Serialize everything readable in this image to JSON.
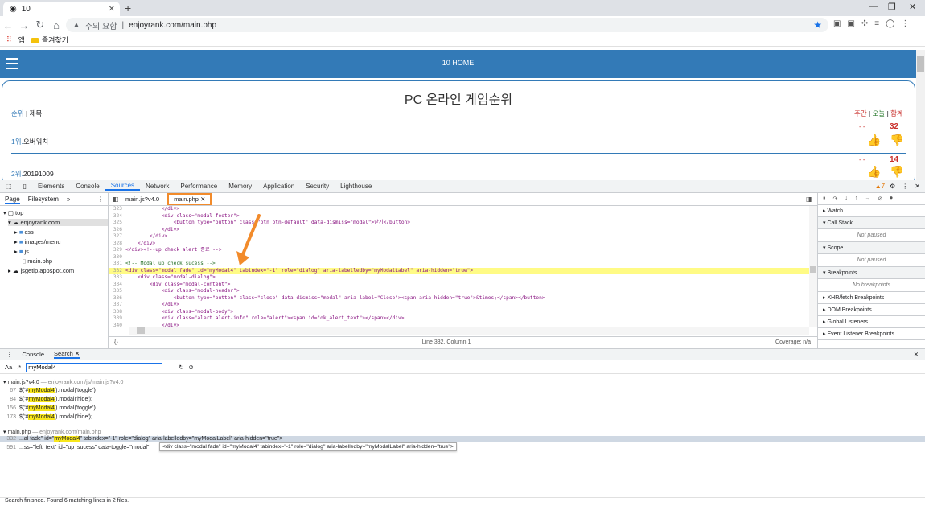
{
  "browser": {
    "tab_title": "10",
    "new_tab": "+",
    "address_warning": "주의 요함",
    "url": "enjoyrank.com/main.php",
    "bookmarks": [
      "앱",
      "즐겨찾기"
    ]
  },
  "page": {
    "nav_title": "10 HOME",
    "title": "PC 온라인 게임순위",
    "left_links": {
      "rank": "순위",
      "sep": " | ",
      "title": "제목"
    },
    "right_links": {
      "weekly": "주간",
      "sep1": " | ",
      "today": "오늘",
      "sep2": " | ",
      "total": "합계"
    },
    "rows": [
      {
        "rank": "1위.",
        "name": "오버워치",
        "dashes": "-    -   ",
        "count": "32"
      },
      {
        "rank": "2위.",
        "name": "20191009",
        "dashes": "-    -   ",
        "count": "14"
      }
    ]
  },
  "devtools": {
    "tabs": [
      "Elements",
      "Console",
      "Sources",
      "Network",
      "Performance",
      "Memory",
      "Application",
      "Security",
      "Lighthouse"
    ],
    "active_tab": "Sources",
    "warning_count": "7",
    "navigator": {
      "tabs": [
        "Page",
        "Filesystem"
      ],
      "tree": [
        {
          "label": "top",
          "level": 0
        },
        {
          "label": "enjoyrank.com",
          "level": 1
        },
        {
          "label": "css",
          "level": 2
        },
        {
          "label": "images/menu",
          "level": 2
        },
        {
          "label": "js",
          "level": 2
        },
        {
          "label": "main.php",
          "level": 2
        },
        {
          "label": "jsgetip.appspot.com",
          "level": 1
        }
      ]
    },
    "editor_tabs": [
      "main.js?v4.0",
      "main.php"
    ],
    "status": {
      "format": "{}",
      "position": "Line 332, Column 1",
      "coverage": "Coverage: n/a"
    },
    "code_lines": [
      {
        "n": "323",
        "t": "            </div>"
      },
      {
        "n": "324",
        "t": "            <div class=\"modal-footer\">"
      },
      {
        "n": "325",
        "t": "                <button type=\"button\" class=\"btn btn-default\" data-dismiss=\"modal\">닫기</button>"
      },
      {
        "n": "326",
        "t": "            </div>"
      },
      {
        "n": "327",
        "t": "        </div>"
      },
      {
        "n": "328",
        "t": "    </div>"
      },
      {
        "n": "329",
        "t": "</div><!--up check alert 종료 -->"
      },
      {
        "n": "330",
        "t": ""
      },
      {
        "n": "331",
        "t": "<!-- Modal up check sucess -->"
      },
      {
        "n": "332",
        "t": "<div class=\"modal fade\" id=\"myModal4\" tabindex=\"-1\" role=\"dialog\" aria-labelledby=\"myModalLabel\" aria-hidden=\"true\">"
      },
      {
        "n": "333",
        "t": "    <div class=\"modal-dialog\">"
      },
      {
        "n": "334",
        "t": "        <div class=\"modal-content\">"
      },
      {
        "n": "335",
        "t": "            <div class=\"modal-header\">"
      },
      {
        "n": "336",
        "t": "                <button type=\"button\" class=\"close\" data-dismiss=\"modal\" aria-label=\"Close\"><span aria-hidden=\"true\">&times;</span></button>"
      },
      {
        "n": "337",
        "t": "            </div>"
      },
      {
        "n": "338",
        "t": "            <div class=\"modal-body\">"
      },
      {
        "n": "339",
        "t": "            <div class=\"alert alert-info\" role=\"alert\"><span id=\"ok_alert_text\"></span></div>"
      },
      {
        "n": "340",
        "t": "            </div>"
      },
      {
        "n": "341",
        "t": ""
      }
    ],
    "debugger": {
      "watch": "Watch",
      "call_stack": "Call Stack",
      "not_paused": "Not paused",
      "scope": "Scope",
      "breakpoints": "Breakpoints",
      "no_breakpoints": "No breakpoints",
      "xhr": "XHR/fetch Breakpoints",
      "dom": "DOM Breakpoints",
      "global": "Global Listeners",
      "event": "Event Listener Breakpoints"
    },
    "drawer": {
      "tabs": [
        "Console",
        "Search"
      ],
      "aa": "Aa",
      "regex": ".*",
      "query": "myModal4",
      "files": [
        {
          "name": "main.js?v4.0",
          "path": "— enjoyrank.com/js/main.js?v4.0",
          "lines": [
            {
              "n": "67",
              "pre": "$('#",
              "match": "myModal4",
              "post": "').modal('toggle')"
            },
            {
              "n": "84",
              "pre": "$('#",
              "match": "myModal4",
              "post": "').modal('hide');"
            },
            {
              "n": "156",
              "pre": "$('#",
              "match": "myModal4",
              "post": "').modal('toggle')"
            },
            {
              "n": "173",
              "pre": "$('#",
              "match": "myModal4",
              "post": "').modal('hide');"
            }
          ]
        },
        {
          "name": "main.php",
          "path": "— enjoyrank.com/main.php",
          "lines": [
            {
              "n": "332",
              "pre": "...al fade\" id=\"",
              "match": "myModal4",
              "post": "\" tabindex=\"-1\" role=\"dialog\" aria-labelledby=\"myModalLabel\" aria-hidden=\"true\">"
            },
            {
              "n": "591",
              "pre": "...ss=\"left_text\" id=\"up_sucess\" data-toggle=\"modal\"",
              "match": "",
              "post": ""
            }
          ]
        }
      ],
      "tooltip": "<div class=\"modal fade\" id=\"myModal4\" tabindex=\"-1\" role=\"dialog\" aria-labelledby=\"myModalLabel\" aria-hidden=\"true\">",
      "status": "Search finished.  Found 6 matching lines in 2 files."
    }
  },
  "colors": {
    "accent": "#337ab7",
    "highlight": "#fffb85",
    "annotation": "#f28b2b"
  }
}
